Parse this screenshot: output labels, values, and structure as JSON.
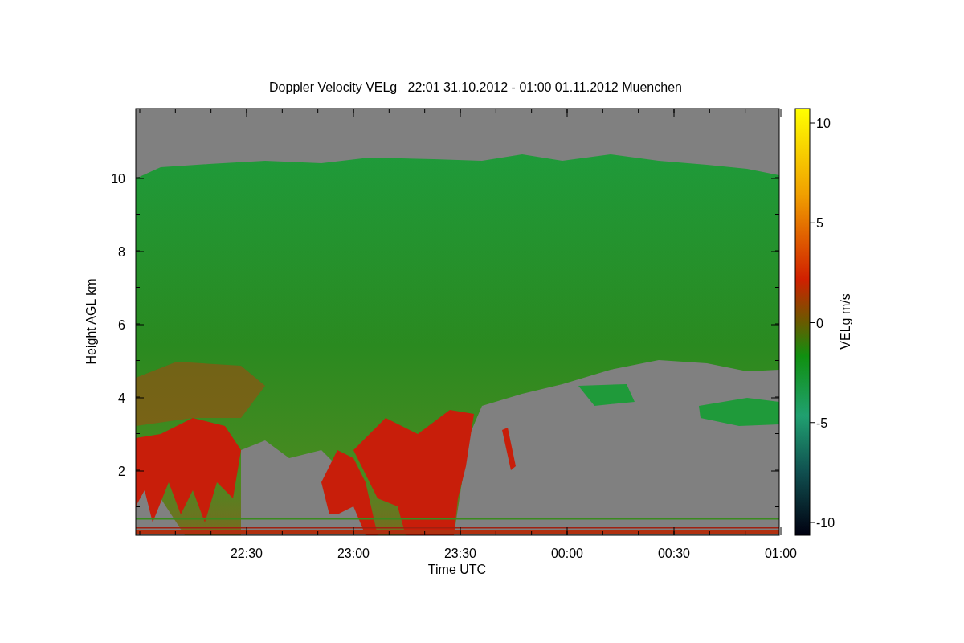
{
  "title": "Doppler Velocity VELg   22:01 31.10.2012 - 01:00 01.11.2012 Muenchen",
  "x_axis": {
    "label": "Time UTC",
    "ticks": [
      "22:30",
      "23:00",
      "23:30",
      "00:00",
      "00:30",
      "01:00"
    ]
  },
  "y_axis": {
    "label": "Height AGL km",
    "ticks": [
      "10",
      "8",
      "6",
      "4",
      "2"
    ]
  },
  "colorbar": {
    "label": "VELg m/s",
    "ticks": [
      "10",
      "5",
      "0",
      "-5",
      "-10"
    ]
  }
}
